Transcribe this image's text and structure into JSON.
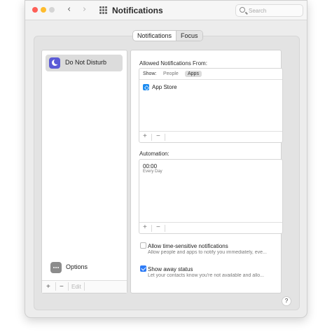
{
  "window": {
    "title": "Notifications",
    "search_placeholder": "Search"
  },
  "tabs": {
    "items": [
      "Notifications",
      "Focus"
    ],
    "selected": "Focus"
  },
  "sidebar": {
    "items": [
      {
        "label": "Do Not Disturb",
        "icon": "moon-icon",
        "selected": true
      }
    ],
    "options_label": "Options",
    "bottom": {
      "add": "+",
      "remove": "−",
      "edit": "Edit"
    }
  },
  "allowed": {
    "heading": "Allowed Notifications From:",
    "show_label": "Show:",
    "filters": [
      "People",
      "Apps"
    ],
    "selected_filter": "Apps",
    "apps": [
      {
        "name": "App Store",
        "icon": "app-store-icon"
      }
    ],
    "footer": {
      "add": "+",
      "remove": "−"
    }
  },
  "automation": {
    "heading": "Automation:",
    "items": [
      {
        "time": "00:00",
        "schedule": "Every Day"
      }
    ],
    "footer": {
      "add": "+",
      "remove": "−"
    }
  },
  "settings": {
    "time_sensitive": {
      "label": "Allow time-sensitive notifications",
      "description": "Allow people and apps to notify you immediately, eve...",
      "checked": false
    },
    "away_status": {
      "label": "Show away status",
      "description": "Let your contacts know you're not available and allo...",
      "checked": true
    }
  },
  "help_label": "?",
  "colors": {
    "accent": "#2f7cf6",
    "focus_icon": "#5b5bd6",
    "app_store": "#1c8bf0"
  }
}
